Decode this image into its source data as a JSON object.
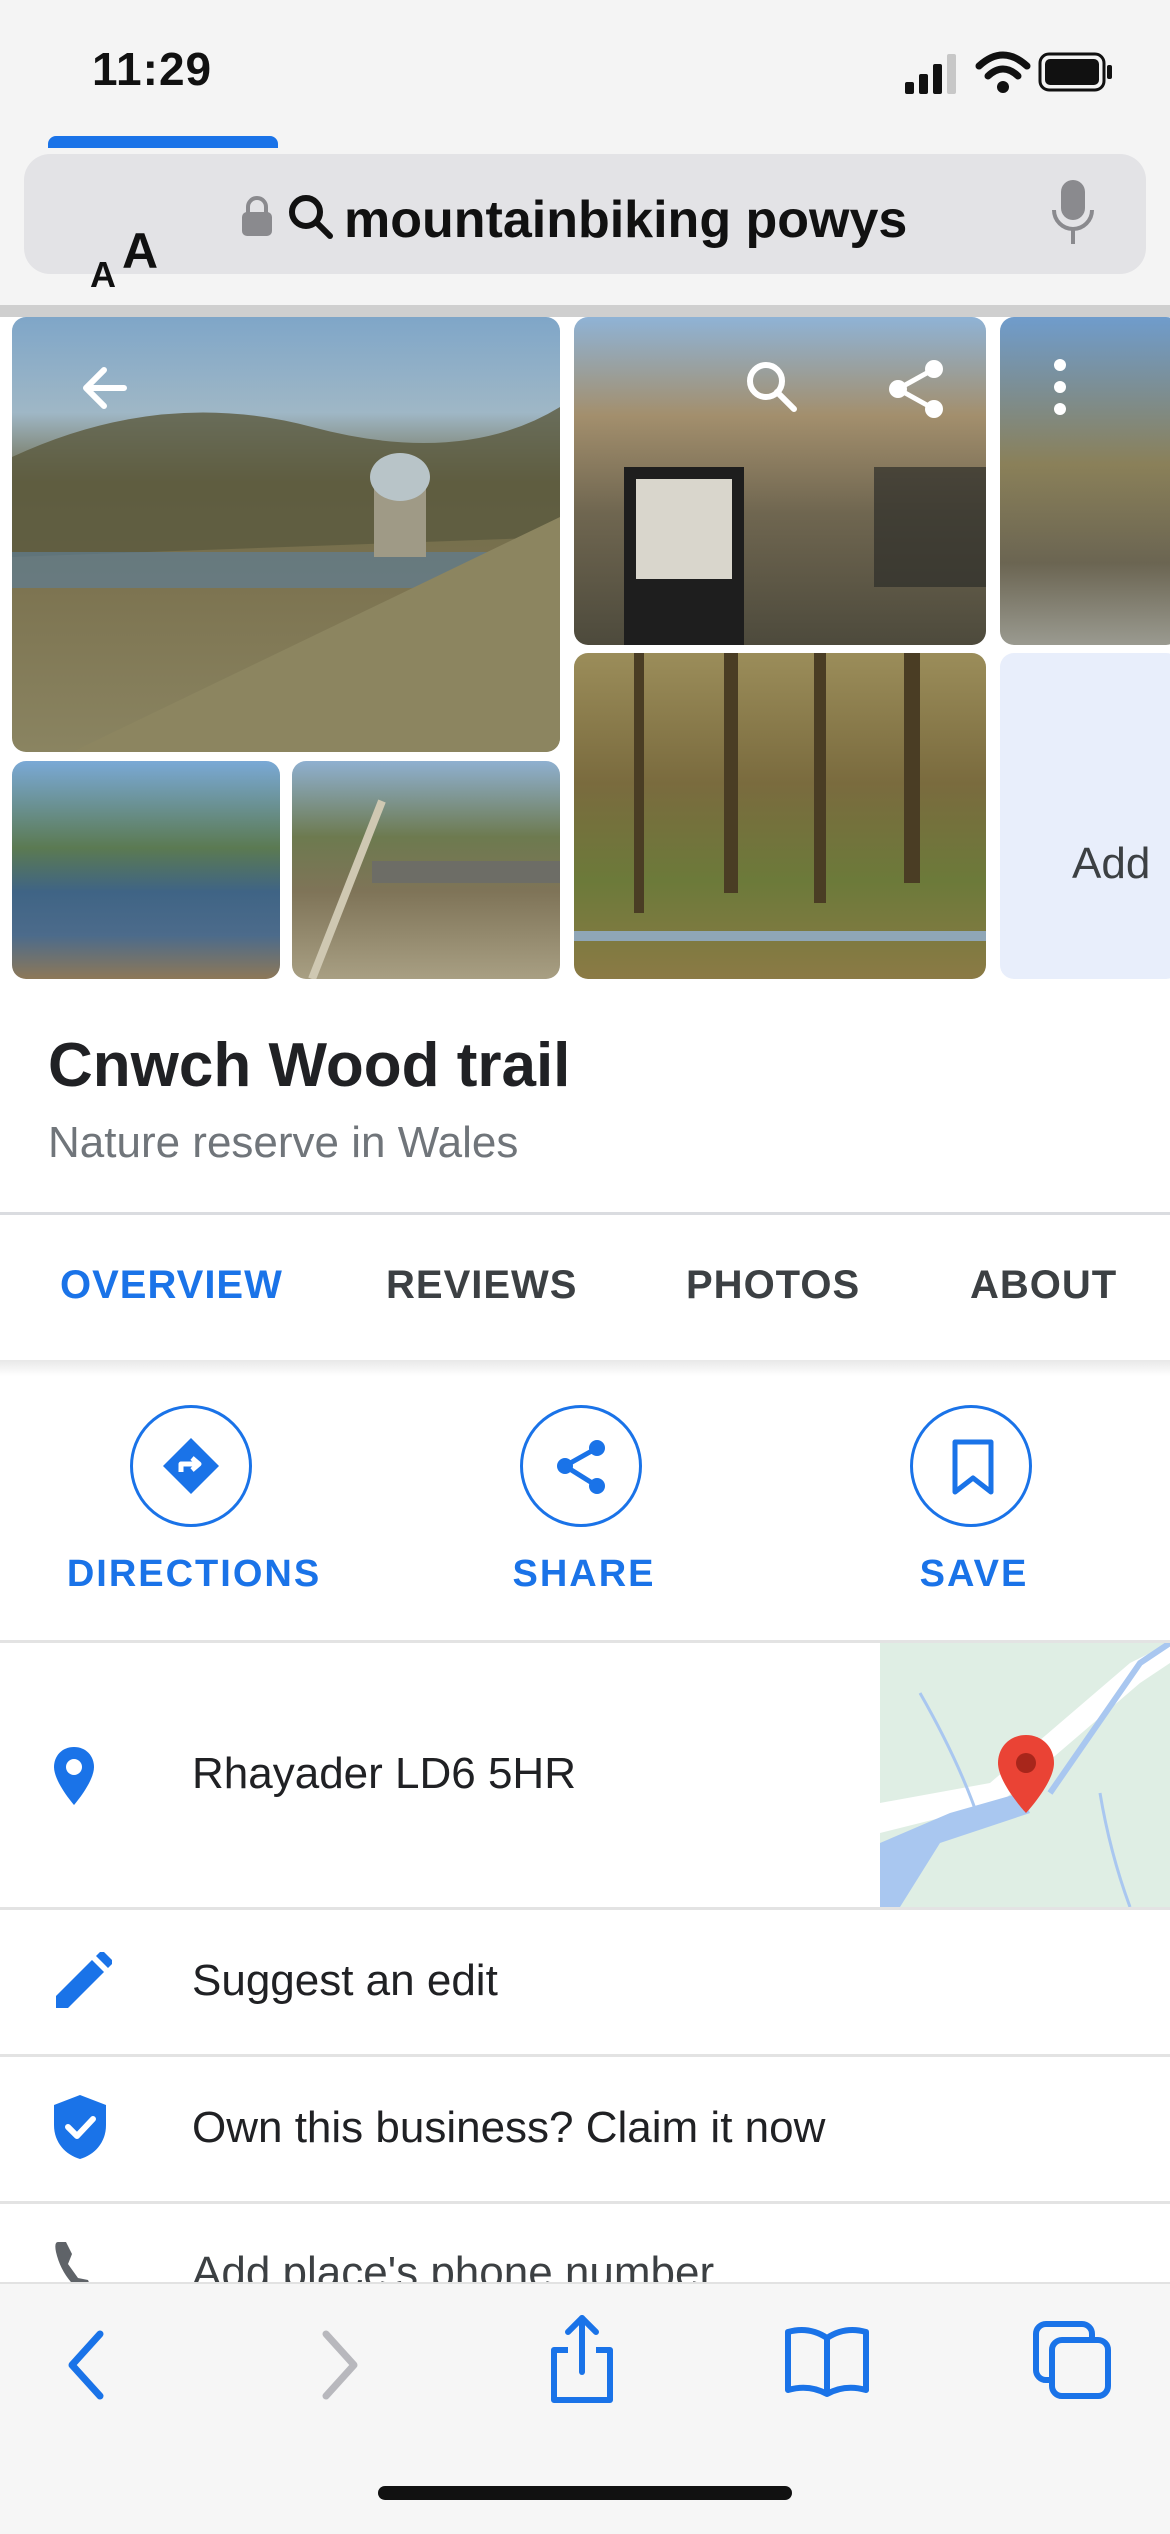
{
  "status_bar": {
    "time": "11:29"
  },
  "address_bar": {
    "aa_small": "A",
    "aa_big": "A",
    "url": "mountainbiking powys"
  },
  "gallery": {
    "add_label": "Add"
  },
  "place": {
    "title": "Cnwch Wood trail",
    "subtitle": "Nature reserve in Wales"
  },
  "tabs": [
    {
      "label": "OVERVIEW",
      "selected": true
    },
    {
      "label": "REVIEWS",
      "selected": false
    },
    {
      "label": "PHOTOS",
      "selected": false
    },
    {
      "label": "ABOUT",
      "selected": false
    }
  ],
  "actions": {
    "directions": "DIRECTIONS",
    "share": "SHARE",
    "save": "SAVE"
  },
  "rows": {
    "address": "Rhayader LD6 5HR",
    "suggest": "Suggest an edit",
    "claim": "Own this business? Claim it now",
    "phone": "Add place's phone number"
  },
  "colors": {
    "accent": "#1a73e8",
    "pin": "#ea4335"
  }
}
